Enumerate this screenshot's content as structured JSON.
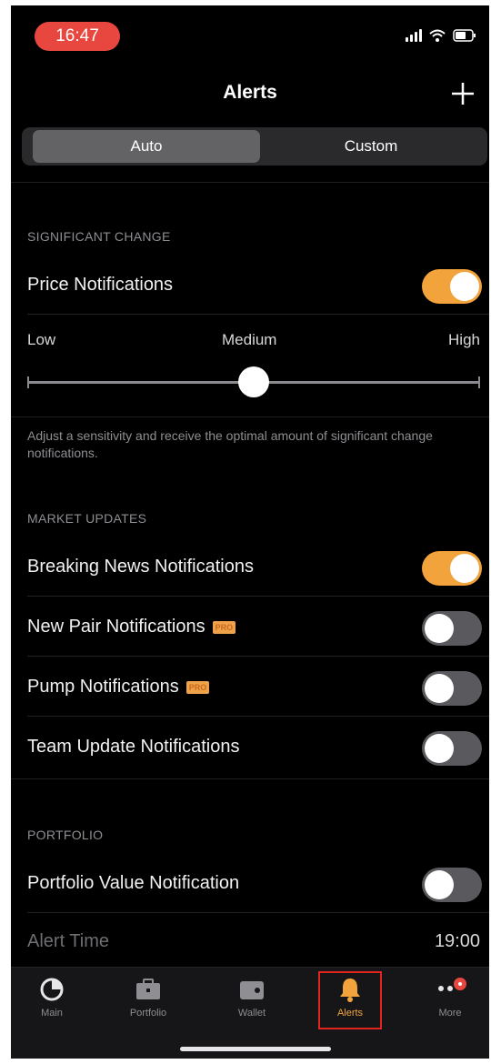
{
  "status_bar": {
    "time": "16:47"
  },
  "header": {
    "title": "Alerts"
  },
  "segments": [
    {
      "label": "Auto",
      "selected": true
    },
    {
      "label": "Custom",
      "selected": false
    }
  ],
  "significant_change": {
    "heading": "SIGNIFICANT CHANGE",
    "price_notifications": {
      "label": "Price Notifications",
      "on": true
    },
    "sensitivity": {
      "low": "Low",
      "medium": "Medium",
      "high": "High",
      "value": 0.5
    },
    "description": "Adjust a sensitivity and receive the optimal amount of significant change notifications."
  },
  "market_updates": {
    "heading": "MARKET UPDATES",
    "items": [
      {
        "label": "Breaking News Notifications",
        "on": true,
        "pro": ""
      },
      {
        "label": "New Pair Notifications",
        "on": false,
        "pro": "PRO"
      },
      {
        "label": "Pump Notifications",
        "on": false,
        "pro": "PRO"
      },
      {
        "label": "Team Update Notifications",
        "on": false,
        "pro": ""
      }
    ]
  },
  "portfolio": {
    "heading": "PORTFOLIO",
    "portfolio_value": {
      "label": "Portfolio Value Notification",
      "on": false
    },
    "alert_time": {
      "label": "Alert Time",
      "value": "19:00"
    }
  },
  "tabbar": {
    "tabs": [
      {
        "label": "Main",
        "icon": "pie-chart-icon"
      },
      {
        "label": "Portfolio",
        "icon": "briefcase-icon"
      },
      {
        "label": "Wallet",
        "icon": "wallet-icon"
      },
      {
        "label": "Alerts",
        "icon": "bell-icon",
        "active": true
      },
      {
        "label": "More",
        "icon": "more-icon"
      }
    ]
  },
  "colors": {
    "accent": "#f2a33c",
    "time_pill": "#e8473f",
    "highlight_box": "#e0251d"
  }
}
